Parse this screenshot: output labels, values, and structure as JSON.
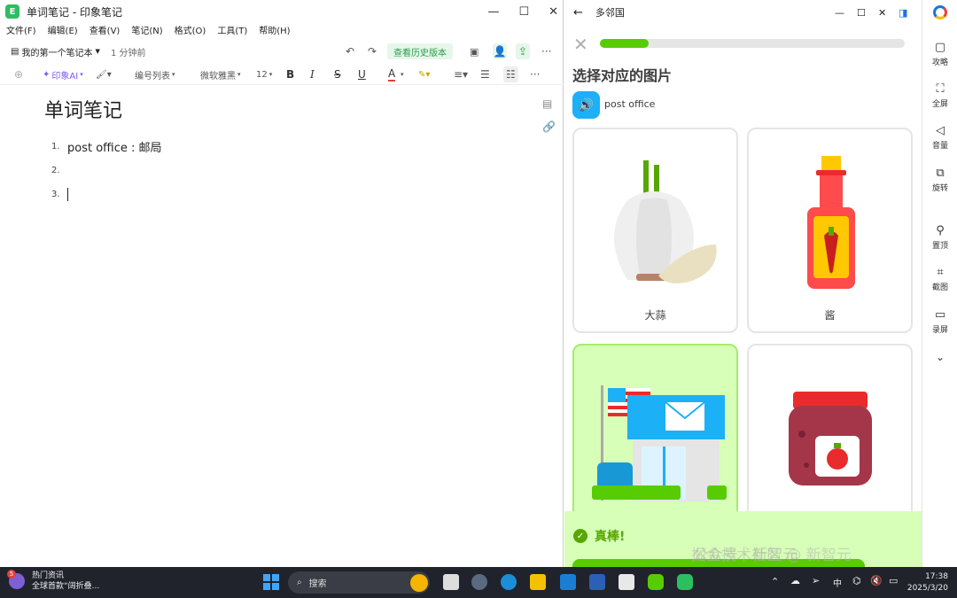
{
  "left": {
    "window_title": "单词笔记 - 印象笔记",
    "app_logo": "evernote-elephant-icon",
    "menu": [
      "文件(F)",
      "编辑(E)",
      "查看(V)",
      "笔记(N)",
      "格式(O)",
      "工具(T)",
      "帮助(H)"
    ],
    "notebook": "我的第一个笔记本",
    "time": "1 分钟前",
    "history_button": "查看历史版本",
    "toolbar": {
      "ai": "印象AI",
      "list_style": "编号列表",
      "font": "微软雅黑",
      "size": "12",
      "bold": "B",
      "italic": "I",
      "strike": "S",
      "underline": "U",
      "font_color": "A",
      "more": "···"
    },
    "note_title": "单词笔记",
    "list_items": [
      {
        "num": "1.",
        "text": "post office : 邮局"
      },
      {
        "num": "2.",
        "text": ""
      },
      {
        "num": "3.",
        "text": ""
      }
    ]
  },
  "right": {
    "window_title": "多邻国",
    "progress": 0.16,
    "question": "选择对应的图片",
    "word": "post office",
    "cards": [
      {
        "label": "大蒜",
        "selected": false
      },
      {
        "label": "酱",
        "selected": false
      },
      {
        "label": "",
        "selected": true
      },
      {
        "label": "",
        "selected": false
      }
    ],
    "feedback": "真棒!",
    "sidebar": [
      "攻略",
      "全屏",
      "音量",
      "旋转",
      "置顶",
      "截图",
      "录屏"
    ]
  },
  "watermark": "掘金技术社区 @ 新智元",
  "watermark_bg": "公众号 · 新智元",
  "taskbar": {
    "news_badge": "5",
    "news_title": "热门资讯",
    "news_sub": "全球首款“阔折叠...",
    "search": "搜索",
    "ime": "中",
    "time": "17:38",
    "date": "2025/3/20"
  },
  "colors": {
    "duolingo_green": "#58cc02",
    "evernote_green": "#2dbe60",
    "duolingo_blue": "#1cb0f6"
  }
}
